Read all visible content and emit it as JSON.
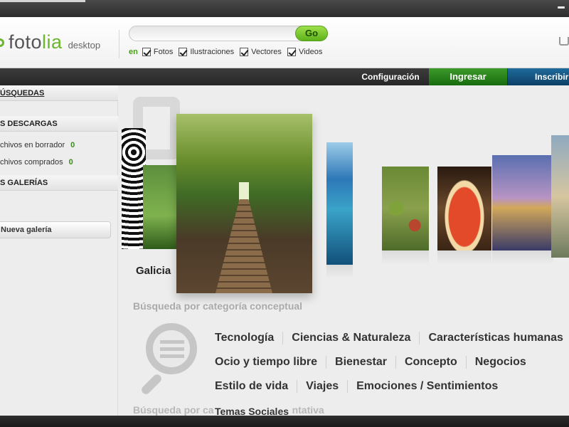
{
  "header": {
    "brand_main": "foto",
    "brand_accent": "lia",
    "brand_sub": "desktop",
    "search_value": "",
    "go_label": "Go",
    "filter_prefix": "en",
    "filters": [
      "Fotos",
      "Ilustraciones",
      "Vectores",
      "Videos"
    ]
  },
  "nav": {
    "config": "Configuración",
    "login": "Ingresar",
    "signup": "Inscribir"
  },
  "sidebar": {
    "searches": "ÚSQUEDAS",
    "downloads": "S DESCARGAS",
    "draft_label": "chivos en borrador",
    "draft_count": "0",
    "bought_label": "chivos comprados",
    "bought_count": "0",
    "galleries": "S GALERÍAS",
    "new_gallery": "Nueva galería"
  },
  "main": {
    "featured_label": "Galicia",
    "category_title": "Búsqueda por categoría conceptual",
    "categories_row1": [
      "Tecnología",
      "Ciencias & Naturaleza",
      "Características humanas"
    ],
    "categories_row2": [
      "Ocio y tiempo libre",
      "Bienestar",
      "Concepto",
      "Negocios"
    ],
    "categories_row3": [
      "Estilo de vida",
      "Viajes",
      "Emociones / Sentimientos"
    ],
    "overlap_text": "Búsqueda por ca",
    "overlap_text_end": "ntativa",
    "categories_row4": [
      "Temas Sociales"
    ]
  },
  "colors": {
    "brand_green": "#6cb52d",
    "login_green": "#176b0e",
    "signup_blue": "#0c3f66"
  }
}
